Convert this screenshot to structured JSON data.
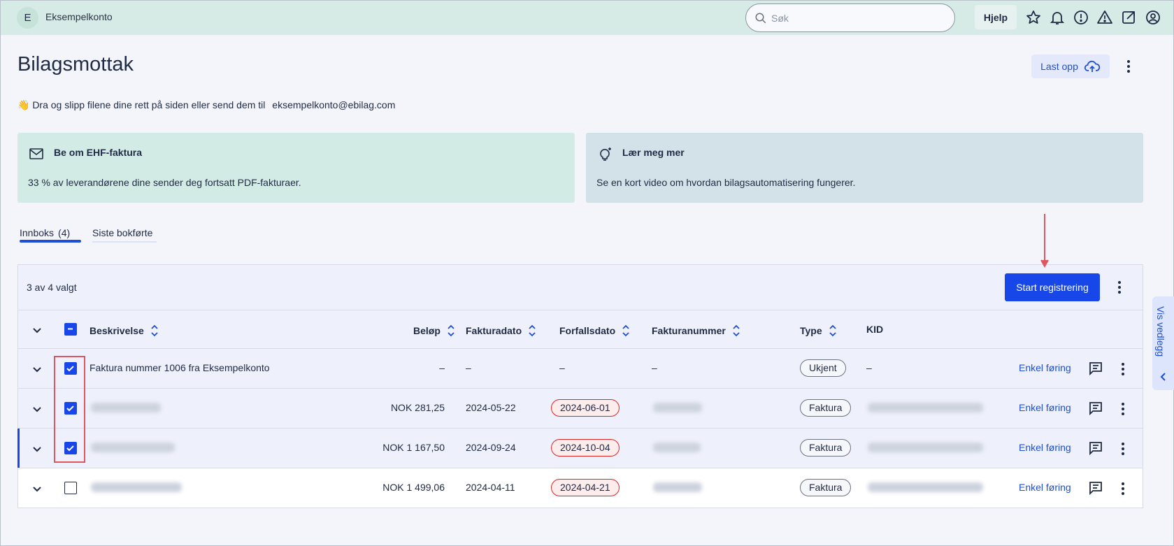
{
  "topbar": {
    "avatar_letter": "E",
    "account_name": "Eksempelkonto",
    "search_placeholder": "Søk",
    "help_label": "Hjelp",
    "icons": [
      "star-icon",
      "bell-icon",
      "alert-circle-icon",
      "warning-triangle-icon",
      "external-link-icon",
      "user-circle-icon"
    ]
  },
  "header": {
    "title": "Bilagsmottak",
    "upload_label": "Last opp"
  },
  "dropzone": {
    "text": "👋 Dra og slipp filene dine rett på siden eller send dem til",
    "email": "eksempelkonto@ebilag.com"
  },
  "cards": [
    {
      "title": "Be om EHF-faktura",
      "text": "33 % av leverandørene dine sender deg fortsatt PDF-fakturaer."
    },
    {
      "title": "Lær meg mer",
      "text": "Se en kort video om hvordan bilagsautomatisering fungerer."
    }
  ],
  "tabs": {
    "inbox_label": "Innboks",
    "inbox_count": "(4)",
    "booked_label": "Siste bokførte"
  },
  "table": {
    "selection_status": "3 av 4 valgt",
    "start_button": "Start registrering",
    "columns": {
      "description": "Beskrivelse",
      "amount": "Beløp",
      "invoice_date": "Fakturadato",
      "due_date": "Forfallsdato",
      "invoice_number": "Fakturanummer",
      "type": "Type",
      "kid": "KID"
    },
    "rows": [
      {
        "checked": true,
        "description": "Faktura nummer 1006 fra Eksempelkonto",
        "amount": "–",
        "invoice_date": "–",
        "due_date": "–",
        "invoice_number": "–",
        "type": "Ukjent",
        "kid": "–",
        "action": "Enkel føring"
      },
      {
        "checked": true,
        "description": "",
        "amount": "NOK 281,25",
        "invoice_date": "2024-05-22",
        "due_date": "2024-06-01",
        "invoice_number": "",
        "type": "Faktura",
        "kid": "",
        "action": "Enkel føring"
      },
      {
        "checked": true,
        "description": "",
        "amount": "NOK 1 167,50",
        "invoice_date": "2024-09-24",
        "due_date": "2024-10-04",
        "invoice_number": "",
        "type": "Faktura",
        "kid": "",
        "action": "Enkel føring"
      },
      {
        "checked": false,
        "description": "",
        "amount": "NOK 1 499,06",
        "invoice_date": "2024-04-11",
        "due_date": "2024-04-21",
        "invoice_number": "",
        "type": "Faktura",
        "kid": "",
        "action": "Enkel føring"
      }
    ]
  },
  "side_panel": {
    "label": "Vis vedlegg"
  },
  "colors": {
    "topbar_bg": "#d6ebe6",
    "primary": "#1747e8",
    "link": "#1d4ed8",
    "overdue_border": "#dc2626",
    "annotation": "#e05563"
  }
}
